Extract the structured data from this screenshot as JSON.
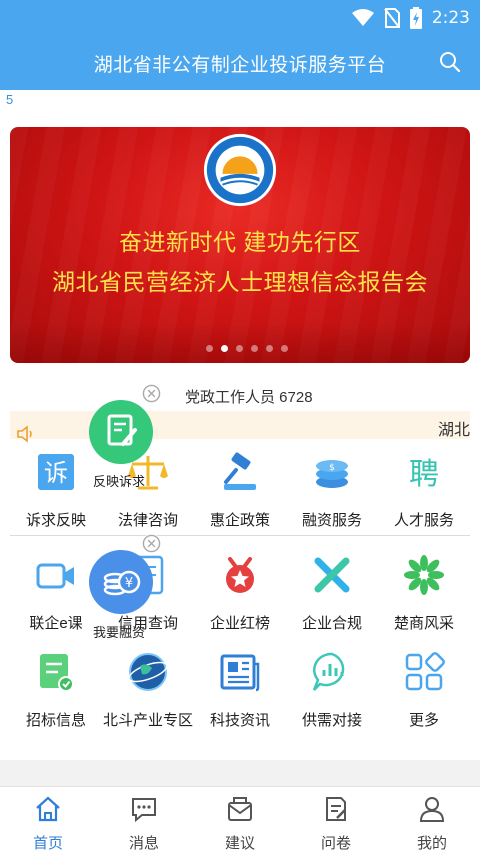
{
  "status_bar": {
    "time": "2:23",
    "icons": [
      "wifi-icon",
      "no-sim-icon",
      "battery-charging-icon"
    ]
  },
  "app_bar": {
    "title": "湖北省非公有制企业投诉服务平台",
    "search_icon": "search-icon"
  },
  "top_ticker": {
    "text": "5"
  },
  "banner": {
    "line1": "奋进新时代 建功先行区",
    "line2": "湖北省民营经济人士理想信念报告会",
    "slide_count": 6,
    "active_slide": 1,
    "background": "#cf1414",
    "text_color": "#ffe24a"
  },
  "staff_line": {
    "text": "党政工作人员 6728"
  },
  "notice": {
    "text": "湖北"
  },
  "grid_row1": [
    {
      "label": "诉求反映",
      "icon": "complaint-icon"
    },
    {
      "label": "法律咨询",
      "icon": "scales-icon"
    },
    {
      "label": "惠企政策",
      "icon": "gavel-icon"
    },
    {
      "label": "融资服务",
      "icon": "coins-icon"
    },
    {
      "label": "人才服务",
      "icon": "recruit-icon"
    }
  ],
  "grid_row2": [
    {
      "label": "联企e课",
      "icon": "video-camera-icon"
    },
    {
      "label": "信用查询",
      "icon": "credit-doc-icon"
    },
    {
      "label": "企业红榜",
      "icon": "star-badge-icon"
    },
    {
      "label": "企业合规",
      "icon": "tools-cross-icon"
    },
    {
      "label": "楚商风采",
      "icon": "flower-icon"
    }
  ],
  "grid_row3": [
    {
      "label": "招标信息",
      "icon": "bid-doc-icon"
    },
    {
      "label": "北斗产业专区",
      "icon": "globe-icon"
    },
    {
      "label": "科技资讯",
      "icon": "news-icon"
    },
    {
      "label": "供需对接",
      "icon": "chat-chart-icon"
    },
    {
      "label": "更多",
      "icon": "apps-grid-icon"
    }
  ],
  "floating": [
    {
      "label": "反映诉求",
      "icon": "edit-note-icon",
      "color": "#35c77a"
    },
    {
      "label": "我要融资",
      "icon": "coin-stack-icon",
      "color": "#4a90e8"
    }
  ],
  "tabs": [
    {
      "label": "首页",
      "icon": "home-icon",
      "active": true
    },
    {
      "label": "消息",
      "icon": "message-icon",
      "active": false
    },
    {
      "label": "建议",
      "icon": "mail-icon",
      "active": false
    },
    {
      "label": "问卷",
      "icon": "survey-icon",
      "active": false
    },
    {
      "label": "我的",
      "icon": "user-icon",
      "active": false
    }
  ],
  "colors": {
    "primary": "#4aa6ee",
    "tab_active": "#2f7fd6"
  }
}
